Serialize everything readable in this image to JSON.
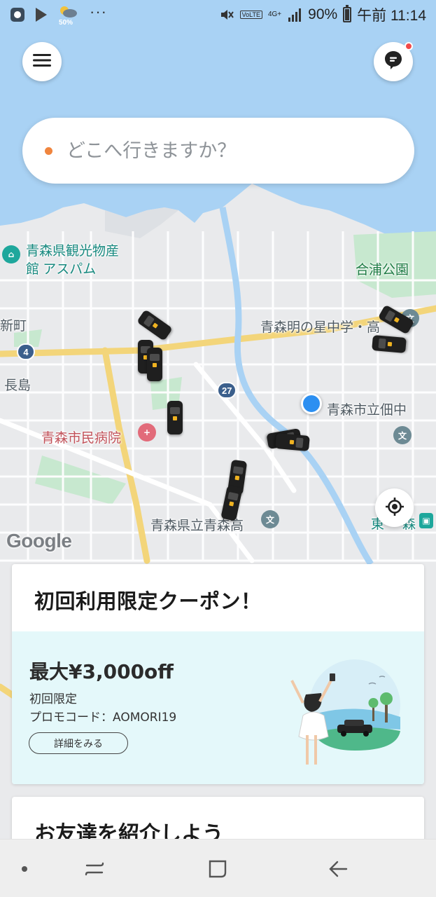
{
  "status_bar": {
    "weather_percent": "50%",
    "more_indicator": "···",
    "volte": "VoLTE",
    "network": "4G+",
    "battery_fraction": 0.9,
    "battery": "90%",
    "clock": "午前 11:14"
  },
  "search": {
    "placeholder": "どこへ行きますか？"
  },
  "map": {
    "labels": {
      "tourist_spot_line1": "青森県観光物産",
      "tourist_spot_line2": "館 アスパム",
      "park": "合浦公園",
      "school_hoshi": "青森明の星中学・高",
      "shinmachi": "新町",
      "nagashima": "長島",
      "school_tsukuda": "青森市立佃中",
      "hospital": "青森市民病院",
      "school_seiryo": "青森県立青森高",
      "station_partial": "東",
      "station_partial_2": "森"
    },
    "route_shields": [
      "4",
      "27"
    ],
    "attribution": "Google"
  },
  "coupon": {
    "title": "初回利用限定クーポン！",
    "amount": "最大¥3,000off",
    "subtitle": "初回限定",
    "promo_code": "プロモコード：AOMORI19",
    "details_button": "詳細をみる"
  },
  "invite": {
    "title": "お友達を紹介しよう"
  },
  "colors": {
    "sea": "#a9d2f4",
    "accent_orange": "#f0853e",
    "user_location": "#2c8ff1",
    "banner_bg": "#e4f8fa"
  },
  "icons": [
    "menu-icon",
    "chat-icon",
    "locate-icon",
    "nav-recents-icon",
    "nav-home-icon",
    "nav-back-icon"
  ]
}
